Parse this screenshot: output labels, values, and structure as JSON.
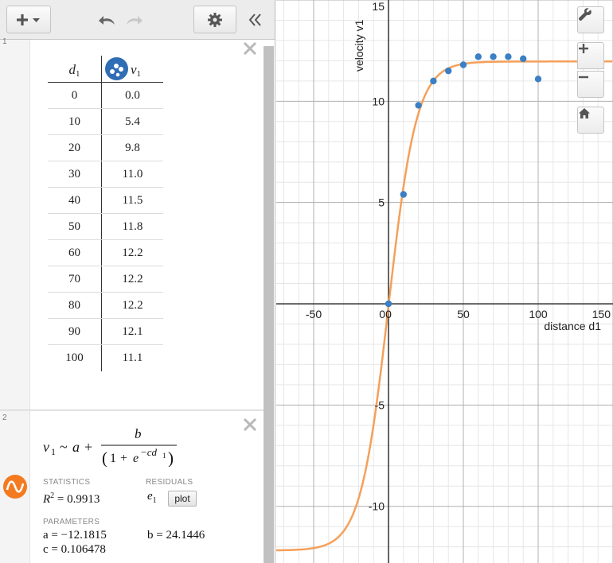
{
  "expressions": [
    {
      "number": "1",
      "table": {
        "x_head": "d",
        "x_sub": "1",
        "y_head": "v",
        "y_sub": "1",
        "rows": [
          {
            "x": "0",
            "y": "0.0"
          },
          {
            "x": "10",
            "y": "5.4"
          },
          {
            "x": "20",
            "y": "9.8"
          },
          {
            "x": "30",
            "y": "11.0"
          },
          {
            "x": "40",
            "y": "11.5"
          },
          {
            "x": "50",
            "y": "11.8"
          },
          {
            "x": "60",
            "y": "12.2"
          },
          {
            "x": "70",
            "y": "12.2"
          },
          {
            "x": "80",
            "y": "12.2"
          },
          {
            "x": "90",
            "y": "12.1"
          },
          {
            "x": "100",
            "y": "11.1"
          }
        ]
      }
    },
    {
      "number": "2",
      "regression": {
        "lhs": "v",
        "lhs_sub": "1",
        "tilde": "~",
        "rhs_a": "a",
        "plus": "+",
        "numerator": "b",
        "denom_open": "(",
        "denom_one": "1",
        "denom_plus": "+",
        "denom_e": "e",
        "denom_exp": "−cd",
        "denom_exp_sub": "1",
        "denom_close": ")",
        "statistics_label": "STATISTICS",
        "r2": "R",
        "r2_sup": "2",
        "r2_value": "= 0.9913",
        "residuals_label": "RESIDUALS",
        "residual_var": "e",
        "residual_sub": "1",
        "plot_label": "plot",
        "parameters_label": "PARAMETERS",
        "param_a": "a = −12.1815",
        "param_b": "b = 24.1446",
        "param_c": "c = 0.106478"
      }
    }
  ],
  "colors": {
    "curve": "#f5a05a",
    "points": "#3b7fc4",
    "regression_icon": "#f47a20",
    "scatter_icon": "#2f6db5"
  },
  "icons": {
    "add": "plus-icon",
    "undo": "undo-icon",
    "redo": "redo-icon",
    "settings": "gear-icon",
    "collapse": "double-chevron-left-icon",
    "wrench": "wrench-icon",
    "zoom_in": "plus-icon",
    "zoom_out": "minus-icon",
    "home": "home-icon"
  },
  "chart_data": {
    "type": "scatter",
    "xlabel": "distance d1",
    "ylabel": "velocity v1",
    "xlim": [
      -75,
      150
    ],
    "ylim": [
      -12.8,
      15
    ],
    "x_ticks": [
      -50,
      0,
      50,
      100,
      150
    ],
    "y_ticks": [
      -10,
      -5,
      5,
      10,
      15
    ],
    "x_tick_labels": [
      "-50",
      "0",
      "50",
      "100",
      "150"
    ],
    "y_tick_labels": [
      "-10",
      "-5",
      "5",
      "10",
      "15"
    ],
    "grid": true,
    "series": [
      {
        "x": [
          0,
          10,
          20,
          30,
          40,
          50,
          60,
          70,
          80,
          90,
          100
        ],
        "y": [
          0.0,
          5.4,
          9.8,
          11.0,
          11.5,
          11.8,
          12.2,
          12.2,
          12.2,
          12.1,
          11.1
        ]
      }
    ],
    "fit": {
      "type": "logistic",
      "a": -12.1815,
      "b": 24.1446,
      "c": 0.106478
    }
  }
}
